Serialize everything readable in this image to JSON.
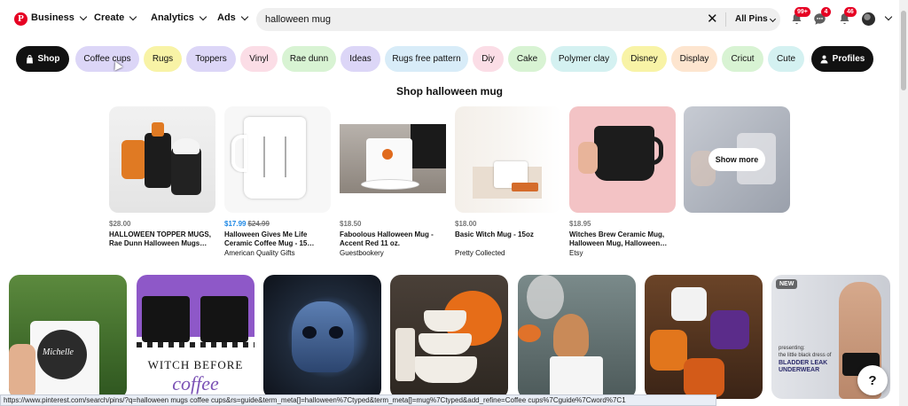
{
  "header": {
    "logo_letter": "P",
    "nav": [
      "Business",
      "Create",
      "Analytics",
      "Ads"
    ],
    "search_value": "halloween mug",
    "clear_label": "✕",
    "scope_label": "All Pins",
    "notifications": {
      "updates": "99+",
      "messages": "4",
      "alerts": "46"
    }
  },
  "pills": [
    {
      "label": "Shop",
      "icon": "shopping-bag-icon",
      "bg": "#111111"
    },
    {
      "label": "Coffee cups",
      "bg": "#dcd6f7"
    },
    {
      "label": "Rugs",
      "bg": "#f8f3a6"
    },
    {
      "label": "Toppers",
      "bg": "#dcd6f7"
    },
    {
      "label": "Vinyl",
      "bg": "#fbdde6"
    },
    {
      "label": "Rae dunn",
      "bg": "#d8f3d3"
    },
    {
      "label": "Ideas",
      "bg": "#dcd6f7"
    },
    {
      "label": "Rugs free pattern",
      "bg": "#d8ecf8"
    },
    {
      "label": "Diy",
      "bg": "#fbdde6"
    },
    {
      "label": "Cake",
      "bg": "#d8f3d3"
    },
    {
      "label": "Polymer clay",
      "bg": "#d4f1f1"
    },
    {
      "label": "Disney",
      "bg": "#f8f3a6"
    },
    {
      "label": "Display",
      "bg": "#fde5cf"
    },
    {
      "label": "Cricut",
      "bg": "#d8f3d3"
    },
    {
      "label": "Cute",
      "bg": "#d4f1f1"
    },
    {
      "label": "Profiles",
      "icon": "person-icon",
      "bg": "#111111"
    }
  ],
  "shop": {
    "title": "Shop halloween mug",
    "products": [
      {
        "price": "$28.00",
        "title": "HALLOWEEN TOPPER MUGS, Rae Dunn Halloween Mugs…",
        "seller": ""
      },
      {
        "price": "$17.99",
        "old_price": "$24.99",
        "title": "Halloween Gives Me Life Ceramic Coffee Mug - 15…",
        "seller": "American Quality Gifts"
      },
      {
        "price": "$18.50",
        "title": "Faboolous Halloween Mug - Accent Red 11 oz.",
        "seller": "Guestbookery"
      },
      {
        "price": "$18.00",
        "title": "Basic Witch Mug - 15oz",
        "seller": "Pretty Collected"
      },
      {
        "price": "$18.95",
        "title": "Witches Brew Ceramic Mug, Halloween Mug, Halloween…",
        "seller": "Etsy"
      }
    ],
    "show_more": "Show more"
  },
  "pin_texts": {
    "mug_name": "Michelle",
    "witch_headline": "WITCH BEFORE",
    "witch_script": "coffee",
    "new_badge": "NEW",
    "underwear_presenting": "presenting:",
    "underwear_tagline": "the little black dress of",
    "underwear_title": "BLADDER LEAK UNDERWEAR"
  },
  "help_label": "?",
  "status_url": "https://www.pinterest.com/search/pins/?q=halloween mugs coffee cups&rs=guide&term_meta[]=halloween%7Ctyped&term_meta[]=mug%7Ctyped&add_refine=Coffee cups%7Cguide%7Cword%7C1"
}
